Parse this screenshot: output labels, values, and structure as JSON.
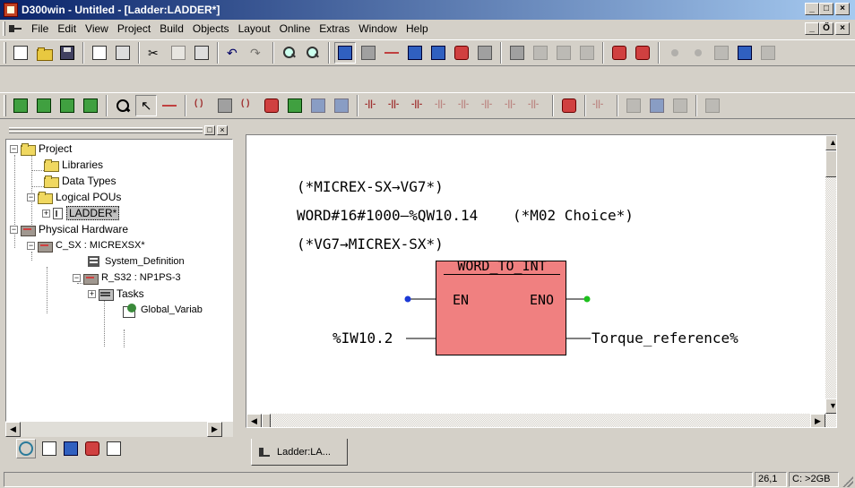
{
  "window": {
    "title": "D300win - Untitled - [Ladder:LADDER*]",
    "controls": [
      "_",
      "□",
      "×"
    ],
    "mdi_controls": [
      "_",
      "Ő",
      "×"
    ]
  },
  "menu": {
    "items": [
      {
        "label": "File"
      },
      {
        "label": "Edit"
      },
      {
        "label": "View"
      },
      {
        "label": "Project"
      },
      {
        "label": "Build"
      },
      {
        "label": "Objects"
      },
      {
        "label": "Layout"
      },
      {
        "label": "Online"
      },
      {
        "label": "Extras"
      },
      {
        "label": "Window"
      },
      {
        "label": "Help"
      }
    ]
  },
  "icons": {
    "toolbar1": [
      "new-icon",
      "open-icon",
      "save-icon",
      "print-preview-icon",
      "print-icon",
      "cut-icon",
      "copy-icon",
      "paste-icon",
      "undo-icon",
      "redo-icon",
      "zoom-in-icon",
      "zoom-out-icon",
      "window-icon",
      "minimize-icon",
      "tools-icon",
      "compile-icon",
      "make-icon",
      "library-icon",
      "online-icon",
      "debug-icon",
      "monitor-icon",
      "upload-icon",
      "cold-start-icon",
      "resource-icon",
      "run-icon",
      "stop-icon",
      "grid-icon",
      "setup-icon",
      "io-icon"
    ],
    "toolbar2": [
      "insert-rung-icon",
      "insert-above-icon",
      "insert-below-icon",
      "delete-rung-icon",
      "find-icon",
      "pointer-icon",
      "line-icon",
      "connect-icon",
      "jump-icon",
      "return-icon",
      "function-icon",
      "fb-icon",
      "variable-icon",
      "contact-icon",
      "contact-neg-icon",
      "contact-pos-icon",
      "contact-p-icon",
      "contact-n-icon",
      "contact-parallel-icon",
      "coil-icon",
      "coil-neg-icon",
      "set-coil-icon",
      "reset-coil-icon",
      "branch-icon",
      "comment-icon",
      "run-once-icon",
      "save-all-icon",
      "view-icon"
    ]
  },
  "tree": {
    "nodes": [
      {
        "label": "Project"
      },
      {
        "label": "Libraries"
      },
      {
        "label": "Data Types"
      },
      {
        "label": "Logical POUs"
      },
      {
        "label": "LADDER*"
      },
      {
        "label": "Physical Hardware"
      },
      {
        "label": "C_SX : MICREXSX*"
      },
      {
        "label": "System_Definition"
      },
      {
        "label": "R_S32 : NP1PS-3"
      },
      {
        "label": "Tasks"
      },
      {
        "label": "Global_Variab"
      }
    ]
  },
  "editor": {
    "comment1": "(*MICREX-SX→VG7*)",
    "assign_line": "WORD#16#1000—%QW10.14",
    "assign_comment": "(*M02 Choice*)",
    "comment2": "(*VG7→MICREX-SX*)",
    "fb_name": "WORD_TO_INT",
    "pin_en": "EN",
    "pin_eno": "ENO",
    "input_var": "%IW10.2",
    "output_var": "Torque_reference%",
    "input_color": "#1c3ad6",
    "output_color": "#1ec01e",
    "fb_color": "#f08080"
  },
  "window_tab": {
    "label": "Ladder:LA..."
  },
  "status": {
    "position": "26,1",
    "memory": "C: >2GB"
  }
}
